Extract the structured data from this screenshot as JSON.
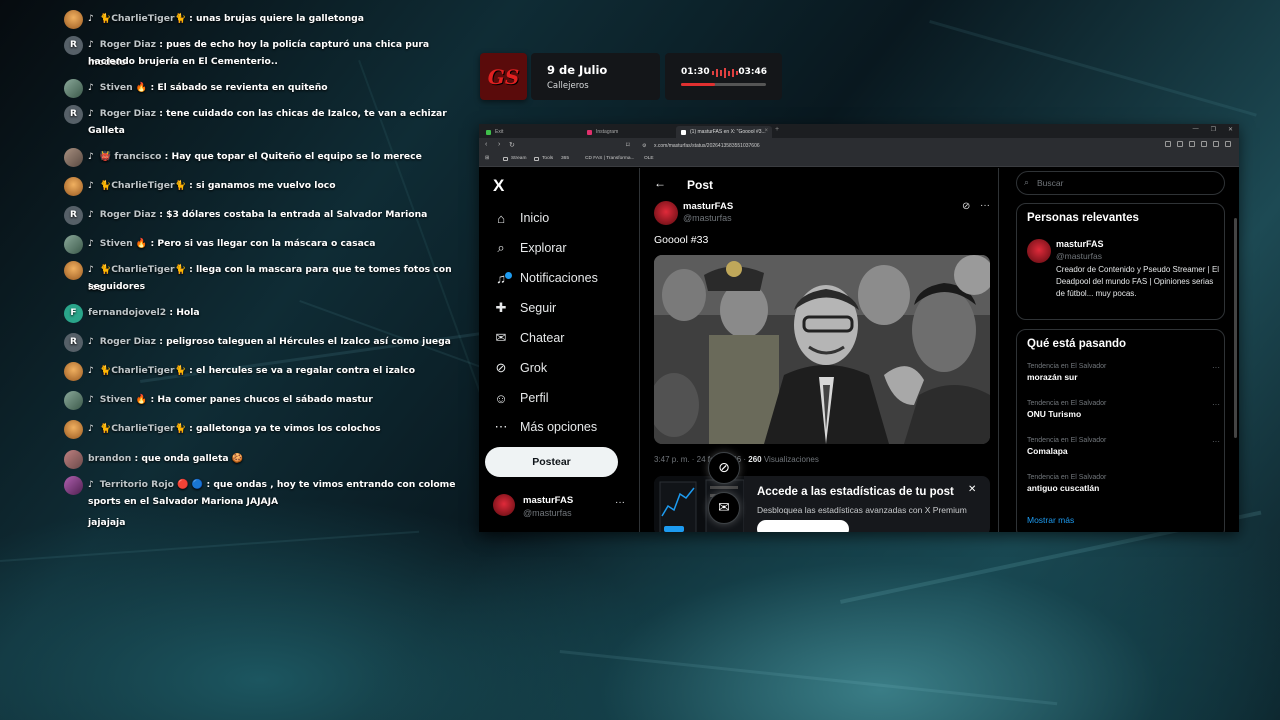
{
  "chat": [
    {
      "avatar": "tiger",
      "badge": "♪",
      "user": "🐈CharlieTiger🐈",
      "text": " : unas brujas quiere la galletonga"
    },
    {
      "avatar": "roger",
      "initial": "R",
      "badge": "♪",
      "user": "Roger Diaz",
      "text": " : pues de echo hoy la policía capturó una chica pura modelo",
      "cont": "haciendo brujería en El Cementerio.."
    },
    {
      "avatar": "stiven",
      "badge": "♪",
      "user": "Stiven 🔥",
      "text": " : El sábado se revienta en quiteño"
    },
    {
      "avatar": "roger",
      "initial": "R",
      "badge": "♪",
      "user": "Roger Diaz",
      "text": " : tene cuidado con las chicas de Izalco, te van a echizar",
      "cont": "Galleta"
    },
    {
      "avatar": "fran",
      "badge": "♪",
      "user": "👹 francisco",
      "text": " : Hay que topar el Quiteño el equipo se lo merece"
    },
    {
      "avatar": "tiger",
      "badge": "♪",
      "user": "🐈CharlieTiger🐈",
      "text": " : si ganamos me vuelvo loco"
    },
    {
      "avatar": "roger",
      "initial": "R",
      "badge": "♪",
      "user": "Roger Diaz",
      "text": " : $3 dólares costaba la entrada al Salvador Mariona"
    },
    {
      "avatar": "stiven",
      "badge": "♪",
      "user": "Stiven 🔥",
      "text": " : Pero si vas llegar con la máscara o casaca"
    },
    {
      "avatar": "tiger",
      "badge": "♪",
      "user": "🐈CharlieTiger🐈",
      "text": " : llega con la mascara para que te tomes fotos con los",
      "cont": "seguidores"
    },
    {
      "avatar": "fer",
      "initial": "F",
      "badge": "",
      "user": "fernandojovel2",
      "text": " : Hola"
    },
    {
      "avatar": "roger",
      "initial": "R",
      "badge": "♪",
      "user": "Roger Diaz",
      "text": " : peligroso taleguen al Hércules el Izalco así como juega"
    },
    {
      "avatar": "tiger",
      "badge": "♪",
      "user": "🐈CharlieTiger🐈",
      "text": " : el hercules se va a regalar contra el izalco"
    },
    {
      "avatar": "stiven",
      "badge": "♪",
      "user": "Stiven 🔥",
      "text": " : Ha comer panes chucos el sábado mastur"
    },
    {
      "avatar": "tiger",
      "badge": "♪",
      "user": "🐈CharlieTiger🐈",
      "text": " : galletonga ya te vimos los colochos"
    },
    {
      "avatar": "bran",
      "badge": "",
      "user": "brandon",
      "text": " : que onda galleta 🍪"
    },
    {
      "avatar": "terr",
      "badge": "♪",
      "user": "Territorio Rojo 🔴 🔵",
      "text": " : que ondas , hoy te vimos entrando con colome",
      "cont": "sports en el Salvador Mariona JAJAJA",
      "cont2": "jajajaja"
    }
  ],
  "song": {
    "album_text": "GS",
    "title": "9 de Julio",
    "artist": "Callejeros",
    "current": "01:30",
    "total": "03:46",
    "progress": 0.4
  },
  "browser": {
    "tabs": [
      {
        "label": "Exit",
        "color": "#3fbf4a"
      },
      {
        "label": "Instagram",
        "color": "#e1306c"
      },
      {
        "label": "(1) masturFAS en X: \"Gooool #3...",
        "color": "#fff"
      }
    ],
    "new_tab": "+",
    "window_controls": [
      "—",
      "❐",
      "✕"
    ],
    "url": "x.com/masturfas/status/2026413583551037606",
    "bookmarks": [
      "Stream",
      "Tools",
      "365",
      "CD FAS | Transforma...",
      "OLE"
    ]
  },
  "x": {
    "logo": "X",
    "nav": [
      {
        "icon": "⌂",
        "label": "Inicio",
        "name": "nav-inicio"
      },
      {
        "icon": "⌕",
        "label": "Explorar",
        "name": "nav-explorar"
      },
      {
        "icon": "♫",
        "label": "Notificaciones",
        "name": "nav-notificaciones"
      },
      {
        "icon": "✚",
        "label": "Seguir",
        "name": "nav-seguir"
      },
      {
        "icon": "✉",
        "label": "Chatear",
        "name": "nav-chatear"
      },
      {
        "icon": "⊘",
        "label": "Grok",
        "name": "nav-grok"
      },
      {
        "icon": "☺",
        "label": "Perfil",
        "name": "nav-perfil"
      },
      {
        "icon": "⋯",
        "label": "Más opciones",
        "name": "nav-mas-opciones"
      }
    ],
    "post_button": "Postear",
    "profile": {
      "name": "masturFAS",
      "handle": "@masturfas",
      "more": "···"
    },
    "header_back": "←",
    "header_title": "Post",
    "post": {
      "author": "masturFAS",
      "handle": "@masturfas",
      "text": "Gooool #33",
      "time": "3:47 p. m. · 24 feb. 2026 · ",
      "views": "260",
      "views_label": " Visualizaciones"
    },
    "promo": {
      "title": "Accede a las estadísticas de tu post",
      "subtitle": "Desbloquea las estadísticas avanzadas con X Premium",
      "close": "✕"
    },
    "search_placeholder": "Buscar",
    "relevant": {
      "title": "Personas relevantes",
      "name": "masturFAS",
      "handle": "@masturfas",
      "bio": "Creador de Contenido y Pseudo Streamer | El Deadpool del mundo FAS | Opiniones serias de fútbol... muy pocas."
    },
    "trending": {
      "title": "Qué está pasando",
      "items": [
        {
          "context": "Tendencia en El Salvador",
          "name": "morazán sur"
        },
        {
          "context": "Tendencia en El Salvador",
          "name": "ONU Turismo"
        },
        {
          "context": "Tendencia en El Salvador",
          "name": "Comalapa"
        },
        {
          "context": "Tendencia en El Salvador",
          "name": "antiguo cuscatlán"
        }
      ],
      "more_dots": "···",
      "show_more": "Mostrar más"
    }
  }
}
